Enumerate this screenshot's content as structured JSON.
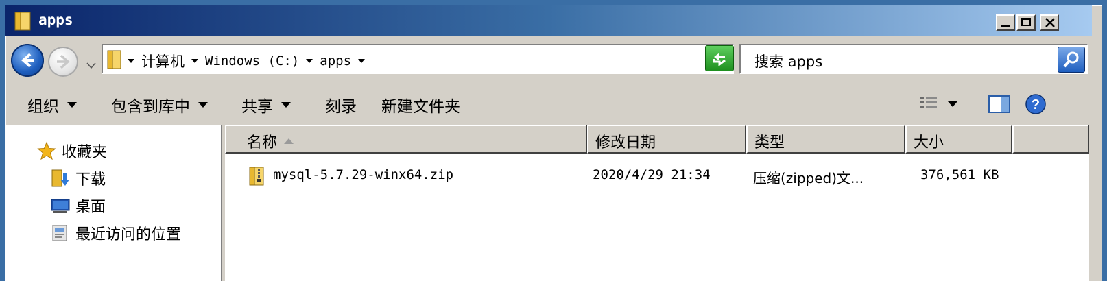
{
  "window": {
    "title": "apps",
    "controls": {
      "minimize": "_",
      "maximize": "□",
      "close": "×"
    }
  },
  "address_bar": {
    "breadcrumbs": [
      "计算机",
      "Windows (C:)",
      "apps"
    ],
    "icon": "folder-icon"
  },
  "search": {
    "placeholder": "搜索 apps"
  },
  "toolbar": {
    "organize": "组织",
    "include_in_library": "包含到库中",
    "share": "共享",
    "burn": "刻录",
    "new_folder": "新建文件夹"
  },
  "nav_pane": {
    "favorites_label": "收藏夹",
    "items": [
      {
        "label": "下载",
        "icon": "downloads-icon"
      },
      {
        "label": "桌面",
        "icon": "desktop-icon"
      },
      {
        "label": "最近访问的位置",
        "icon": "recent-places-icon"
      }
    ]
  },
  "file_list": {
    "columns": [
      "名称",
      "修改日期",
      "类型",
      "大小"
    ],
    "sorted_by": "名称",
    "files": [
      {
        "name": "mysql-5.7.29-winx64.zip",
        "modified": "2020/4/29 21:34",
        "type": "压缩(zipped)文...",
        "size": "376,561 KB",
        "icon": "zip-folder-icon"
      }
    ]
  },
  "colors": {
    "titlebar_start": "#0a246a",
    "titlebar_end": "#a6caf0",
    "desktop": "#3a6ea5",
    "face": "#d4d0c8"
  }
}
